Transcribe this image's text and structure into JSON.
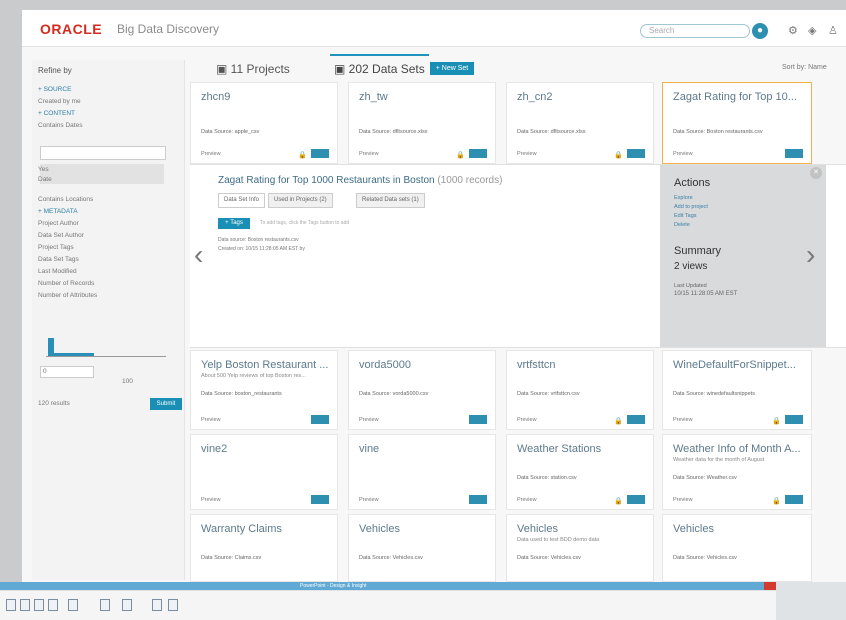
{
  "header": {
    "logo": "ORACLE",
    "app_name": "Big Data Discovery",
    "search_placeholder": "Search",
    "icons": [
      "search-icon",
      "gear-icon",
      "help-icon",
      "user-icon"
    ]
  },
  "tabs": [
    {
      "label": "11 Projects",
      "icon": "project-icon"
    },
    {
      "label": "202 Data Sets",
      "icon": "dataset-icon",
      "active": true
    }
  ],
  "toolbar": {
    "new_button": "+ New Set",
    "sort": "Sort by: Name"
  },
  "sidebar": {
    "title": "Refine by",
    "lines": [
      "+ SOURCE",
      "Created by me",
      "+ CONTENT",
      "Contains Dates",
      "Yes",
      "Date",
      "Contains Locations",
      "+ METADATA",
      "Project Author",
      "Data Set Author",
      "Project Tags",
      "Data Set Tags",
      "Last Modified",
      "Number of Records",
      "Number of Attributes"
    ],
    "range_from": "0",
    "range_to": "100",
    "results": "120 results",
    "submit": "Submit"
  },
  "cards_top": [
    {
      "title": "zhcn9",
      "source": "Data Source: apple_csv",
      "preview": "Preview"
    },
    {
      "title": "zh_tw",
      "source": "Data Source: dfltsource.xlsx",
      "preview": "Preview"
    },
    {
      "title": "zh_cn2",
      "source": "Data Source: dfltsource.xlsx",
      "preview": "Preview"
    },
    {
      "title": "Zagat Rating for Top 10...",
      "source": "Data Source: Boston restaurants.csv",
      "preview": "Preview",
      "highlight": true
    }
  ],
  "detail": {
    "title": "Zagat Rating for Top 1000 Restaurants in Boston",
    "records": "(1000 records)",
    "tabs": [
      "Data Set Info",
      "Used in Projects (2)",
      "Related Data sets (1)"
    ],
    "tag_button": "+ Tags",
    "tag_note": "To add tags, click the Tags button to add",
    "data_source": "Data source: Boston restaurants.csv",
    "created_on": "Created on: 10/15 11:28:05 AM EST by ",
    "actions_title": "Actions",
    "actions": [
      "Explore",
      "Add to project",
      "Edit Tags",
      "Delete"
    ],
    "summary_title": "Summary",
    "summary_value": "2 views",
    "last_updated_label": "Last Updated",
    "last_updated": "10/15 11:28:05 AM EST"
  },
  "cards_mid": [
    {
      "title": "Yelp Boston Restaurant ...",
      "desc": "About 500 Yelp reviews of top Boston res...",
      "source": "Data Source: boston_restaurants",
      "preview": "Preview"
    },
    {
      "title": "vorda5000",
      "desc": "",
      "source": "Data Source: vorda5000.csv",
      "preview": "Preview"
    },
    {
      "title": "vrtfsttcn",
      "desc": "",
      "source": "Data Source: vrtfsttcn.csv",
      "preview": "Preview"
    },
    {
      "title": "WineDefaultForSnippet...",
      "desc": "",
      "source": "Data Source: winedefaultsnippets",
      "preview": "Preview"
    }
  ],
  "cards_row3": [
    {
      "title": "vine2",
      "desc": "",
      "source": "",
      "preview": "Preview"
    },
    {
      "title": "vine",
      "desc": "",
      "source": "",
      "preview": "Preview"
    },
    {
      "title": "Weather Stations",
      "desc": "",
      "source": "Data Source: station.csv",
      "preview": "Preview"
    },
    {
      "title": "Weather Info of Month A...",
      "desc": "Weather data for the month of August",
      "source": "Data Source: Weather.csv",
      "preview": "Preview"
    }
  ],
  "cards_row4": [
    {
      "title": "Warranty Claims",
      "desc": "",
      "source": "Data Source: Claims.csv",
      "preview": ""
    },
    {
      "title": "Vehicles",
      "desc": "",
      "source": "Data Source: Vehicles.csv",
      "preview": ""
    },
    {
      "title": "Vehicles",
      "desc": "Data used to test BDD demo data",
      "source": "Data Source: Vehicles.csv",
      "preview": ""
    },
    {
      "title": "Vehicles",
      "desc": "",
      "source": "Data Source: Vehicles.csv",
      "preview": ""
    }
  ],
  "taskbar": {
    "title": "PowerPoint - Design & Insight"
  }
}
